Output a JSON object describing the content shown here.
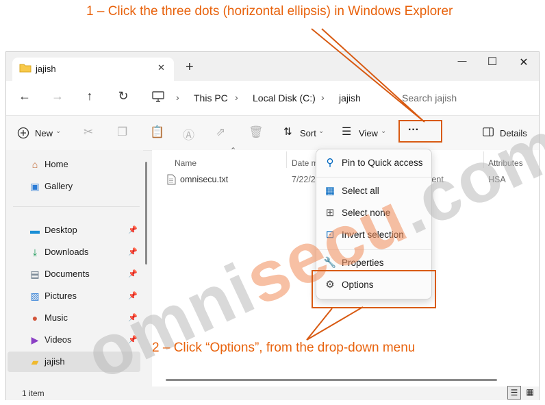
{
  "annotations": {
    "step1": "1 – Click the three dots (horizontal ellipsis) in Windows Explorer",
    "step2": "2 – Click “Options”, from the drop-down menu"
  },
  "watermark": {
    "part1": "omni",
    "part2": "secu",
    "part3": ".com"
  },
  "tab": {
    "title": "jajish",
    "close": "✕",
    "new": "+"
  },
  "window_controls": {
    "minimize": "—",
    "maximize": "☐",
    "close": "✕"
  },
  "nav": {
    "back": "←",
    "forward": "→",
    "up": "↑",
    "refresh": "↻"
  },
  "breadcrumb": [
    "This PC",
    "Local Disk (C:)",
    "jajish"
  ],
  "search": {
    "placeholder": "Search jajish"
  },
  "toolbar": {
    "new_label": "New",
    "sort_label": "Sort",
    "view_label": "View",
    "more_label": "···",
    "details_label": "Details"
  },
  "sidebar": {
    "items": [
      {
        "label": "Home",
        "icon": "home-icon",
        "pinned": false
      },
      {
        "label": "Gallery",
        "icon": "gallery-icon",
        "pinned": false
      },
      {
        "label": "Desktop",
        "icon": "desktop-icon",
        "pinned": true
      },
      {
        "label": "Downloads",
        "icon": "downloads-icon",
        "pinned": true
      },
      {
        "label": "Documents",
        "icon": "documents-icon",
        "pinned": true
      },
      {
        "label": "Pictures",
        "icon": "pictures-icon",
        "pinned": true
      },
      {
        "label": "Music",
        "icon": "music-icon",
        "pinned": true
      },
      {
        "label": "Videos",
        "icon": "videos-icon",
        "pinned": true
      },
      {
        "label": "jajish",
        "icon": "folder-icon",
        "pinned": false,
        "selected": true
      }
    ]
  },
  "columns": {
    "name": "Name",
    "date": "Date m",
    "attributes": "Attributes"
  },
  "file": {
    "name": "omnisecu.txt",
    "date": "7/22/2",
    "type_partial": "ment",
    "attributes": "HSA"
  },
  "menu": {
    "pin": "Pin to Quick access",
    "select_all": "Select all",
    "select_none": "Select none",
    "invert": "Invert selection",
    "properties": "Properties",
    "options": "Options"
  },
  "status": {
    "count": "1 item"
  },
  "colors": {
    "accent": "#0067c0",
    "annotation": "#e8620c",
    "highlight": "#d85a12"
  }
}
